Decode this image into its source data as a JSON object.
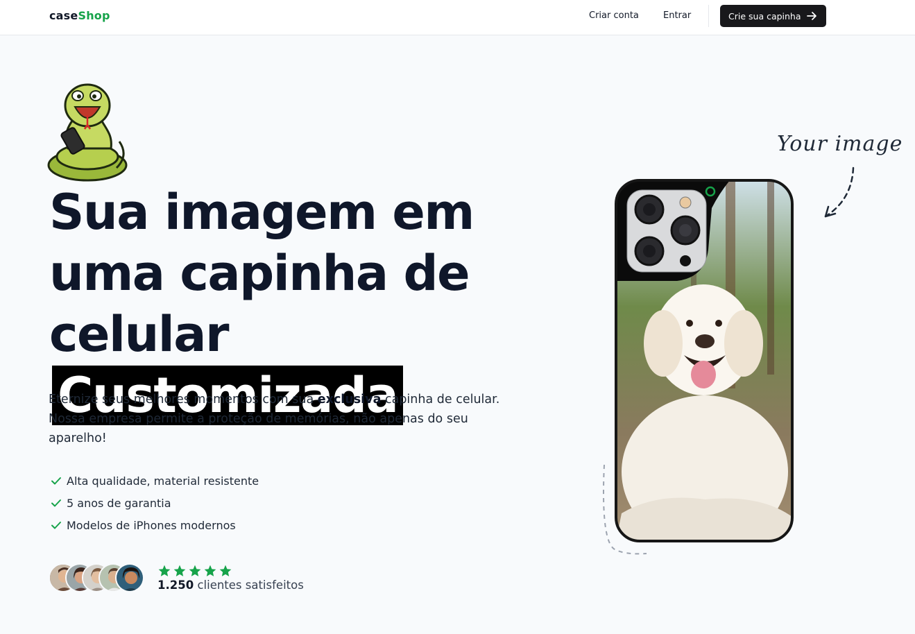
{
  "nav": {
    "logo_part1": "case",
    "logo_part2": "Shop",
    "create_account": "Criar conta",
    "login": "Entrar",
    "cta_label": "Crie sua capinha",
    "cta_icon": "arrow-right-icon"
  },
  "hero": {
    "headline_line1": "Sua imagem em",
    "headline_line2": "uma capinha de",
    "headline_line3": "celular",
    "headline_highlight": "Customizada",
    "desc_part1": "Eternize seus melhores momentos com sua ",
    "desc_bold": "exclusiva",
    "desc_part2": " capinha de celular. Nossa empresa permite a proteção de memórias, não apenas do seu aparelho!",
    "features": [
      "Alta qualidade, material resistente",
      "5 anos de garantia",
      "Modelos de iPhones modernos"
    ],
    "rating_stars": 5,
    "reviews_count": "1.250",
    "reviews_label": " clientes satisfeitos",
    "handwritten_label": "Your image"
  },
  "colors": {
    "accent": "#16a34a",
    "dark": "#18181b",
    "headline": "#0f172a",
    "background": "#f8fafc"
  }
}
